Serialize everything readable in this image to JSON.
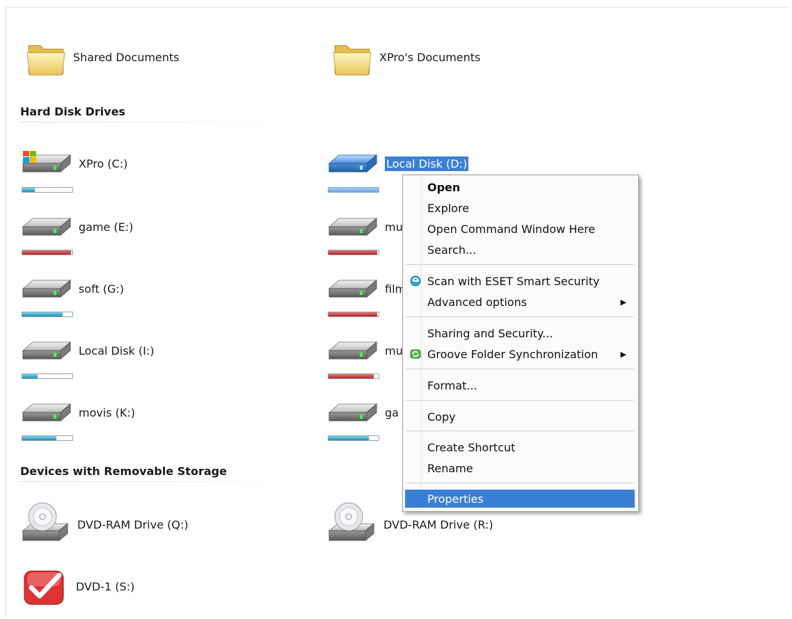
{
  "sections": {
    "hard_disk_drives": "Hard Disk Drives",
    "removable_storage": "Devices with Removable Storage"
  },
  "folders": [
    {
      "label": "Shared Documents",
      "icon": "folder-icon"
    },
    {
      "label": "XPro's Documents",
      "icon": "folder-icon"
    }
  ],
  "drives": [
    {
      "label": "XPro (C:)",
      "icon": "windows-drive-icon",
      "usage": 0.25,
      "status": "ok"
    },
    {
      "label": "Local Disk (D:)",
      "icon": "drive-icon",
      "usage": 1.0,
      "status": "selected"
    },
    {
      "label": "game (E:)",
      "icon": "drive-icon",
      "usage": 0.97,
      "status": "full"
    },
    {
      "label": "mu",
      "icon": "drive-icon",
      "usage": 0.97,
      "status": "full"
    },
    {
      "label": "soft (G:)",
      "icon": "drive-icon",
      "usage": 0.8,
      "status": "ok"
    },
    {
      "label": "film",
      "icon": "drive-icon",
      "usage": 0.97,
      "status": "full"
    },
    {
      "label": "Local Disk (I:)",
      "icon": "drive-icon",
      "usage": 0.3,
      "status": "ok"
    },
    {
      "label": "mu",
      "icon": "drive-icon",
      "usage": 0.9,
      "status": "full"
    },
    {
      "label": "movis (K:)",
      "icon": "drive-icon",
      "usage": 0.68,
      "status": "ok"
    },
    {
      "label": "ga",
      "icon": "drive-icon",
      "usage": 0.8,
      "status": "ok"
    }
  ],
  "removable": [
    {
      "label": "DVD-RAM Drive (Q:)",
      "icon": "dvd-drive-icon"
    },
    {
      "label": "DVD-RAM Drive (R:)",
      "icon": "dvd-drive-icon"
    },
    {
      "label": "DVD-1 (S:)",
      "icon": "dvd-app-icon"
    }
  ],
  "context_menu": {
    "open": "Open",
    "explore": "Explore",
    "open_command_window": "Open Command Window Here",
    "search": "Search...",
    "scan_eset": "Scan with ESET Smart Security",
    "advanced_options": "Advanced options",
    "sharing_security": "Sharing and Security...",
    "groove_sync": "Groove Folder Synchronization",
    "format": "Format...",
    "copy": "Copy",
    "create_shortcut": "Create Shortcut",
    "rename": "Rename",
    "properties": "Properties",
    "submenu_arrow": "▶"
  },
  "colors": {
    "selection": "#3a7fd6",
    "usage_ok": "#1b8fb8",
    "usage_full": "#b52424"
  }
}
